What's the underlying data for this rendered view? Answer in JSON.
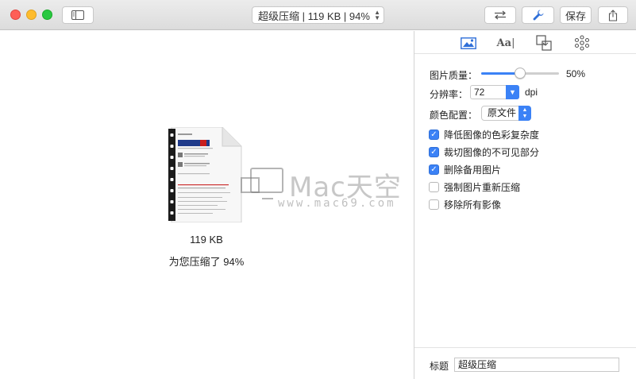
{
  "window": {
    "doc_title": "超级压缩 | 119 KB | 94%"
  },
  "toolbar": {
    "save_label": "保存",
    "icons": [
      "sidebar-icon",
      "swap-arrows-icon",
      "wrench-icon",
      "share-icon"
    ]
  },
  "main": {
    "file_size": "119 KB",
    "compression_message": "为您压缩了 94%"
  },
  "watermark": {
    "title": "Mac天空",
    "url": "www.mac69.com"
  },
  "inspector": {
    "tabs": [
      {
        "name": "image",
        "icon": "image-icon"
      },
      {
        "name": "text",
        "icon": "text-aa-icon"
      },
      {
        "name": "layout",
        "icon": "layers-icon"
      },
      {
        "name": "advanced",
        "icon": "gear-flower-icon"
      }
    ],
    "quality": {
      "label": "图片质量：",
      "value_text": "50%",
      "value": 0.5
    },
    "resolution": {
      "label": "分辨率：",
      "value": "72",
      "unit": "dpi"
    },
    "color_profile": {
      "label": "颜色配置：",
      "value": "原文件"
    },
    "options": [
      {
        "label": "降低图像的色彩复杂度",
        "checked": true
      },
      {
        "label": "裁切图像的不可见部分",
        "checked": true
      },
      {
        "label": "删除备用图片",
        "checked": true
      },
      {
        "label": "强制图片重新压缩",
        "checked": false
      },
      {
        "label": "移除所有影像",
        "checked": false
      }
    ],
    "title_field": {
      "label": "标题",
      "value": "超级压缩"
    }
  },
  "colors": {
    "accent": "#3b82f6",
    "close": "#fe5f57",
    "minimize": "#febc2e",
    "maximize": "#28c840"
  }
}
